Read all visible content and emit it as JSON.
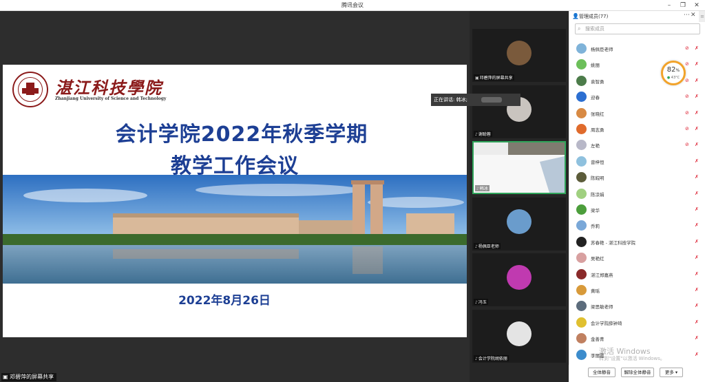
{
  "window": {
    "title": "腾讯会议"
  },
  "speaking": {
    "label": "正在讲话: 韩冰;"
  },
  "slide": {
    "school_cn": "湛江科技學院",
    "school_en": "Zhanjiang University of Science and Technology",
    "title_line1": "会计学院2022年秋季学期",
    "title_line2": "教学工作会议",
    "date": "2022年8月26日"
  },
  "share": {
    "label": "邓碧萍的屏幕共享"
  },
  "video_tiles": [
    {
      "name": "邓碧萍的屏幕共享",
      "color": "#7a5a3c"
    },
    {
      "name": "谢聪蓉",
      "color": "#c9c4bf"
    },
    {
      "name": "韩冰",
      "color": "#e8e8e8"
    },
    {
      "name": "杨佩臣老师",
      "color": "#6a9ccc"
    },
    {
      "name": "冯玉",
      "color": "#c03ab0"
    },
    {
      "name": "会计学院胡依丽",
      "color": "#e4e4e4"
    }
  ],
  "panel": {
    "title": "管理成员(77)",
    "search_placeholder": "搜索成员",
    "members": [
      {
        "name": "杨佩臣老师",
        "color": "#7fb3d9",
        "cam": true
      },
      {
        "name": "姚丽",
        "color": "#6cbf5a",
        "cam": true
      },
      {
        "name": "袁智勇",
        "color": "#4c7c4a",
        "cam": true
      },
      {
        "name": "迎春",
        "color": "#2c6fd1",
        "cam": true
      },
      {
        "name": "张晓红",
        "color": "#d88a44",
        "cam": true
      },
      {
        "name": "周志勇",
        "color": "#e06b2c",
        "cam": true
      },
      {
        "name": "左艳",
        "color": "#b8b8c8",
        "cam": true
      },
      {
        "name": "曾梓恒",
        "color": "#8fc1de",
        "cam": false
      },
      {
        "name": "陈皖明",
        "color": "#5c5c3a",
        "cam": false
      },
      {
        "name": "陈凉娟",
        "color": "#a0d080",
        "cam": false
      },
      {
        "name": "梁华",
        "color": "#4c9e3c",
        "cam": false
      },
      {
        "name": "乔莉",
        "color": "#7aa8d8",
        "cam": false
      },
      {
        "name": "苏春艳 - 湛江科技学院",
        "color": "#222222",
        "cam": false
      },
      {
        "name": "吴艳红",
        "color": "#d8a0a0",
        "cam": false
      },
      {
        "name": "湛江郑嘉燕",
        "color": "#8a2a2a",
        "cam": false
      },
      {
        "name": "黄瑶",
        "color": "#d89a3a",
        "cam": false
      },
      {
        "name": "梁思敏老师",
        "color": "#5c6c7c",
        "cam": false
      },
      {
        "name": "会计学院薛钟琦",
        "color": "#e0c030",
        "cam": false
      },
      {
        "name": "金善青",
        "color": "#c08060",
        "cam": false
      },
      {
        "name": "李丽霞",
        "color": "#3c8ccc",
        "cam": false
      }
    ]
  },
  "perf": {
    "percent": "82",
    "percent_unit": "%",
    "temp": "43°C"
  },
  "watermark": {
    "line1": "激活 Windows",
    "line2": "转到\"设置\"以激活 Windows。"
  },
  "footer": {
    "mute_all": "全体静音",
    "unmute_all": "解除全体静音",
    "more": "更多 ▾"
  }
}
